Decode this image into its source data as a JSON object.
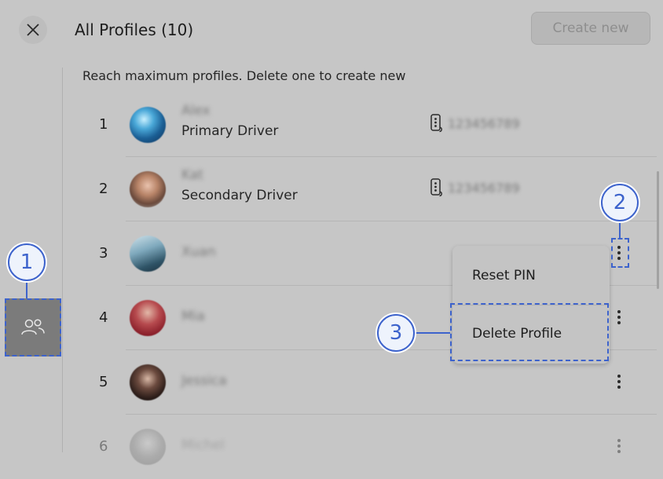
{
  "header": {
    "title": "All Profiles (10)",
    "create_label": "Create new"
  },
  "notice": "Reach maximum profiles. Delete one to create new",
  "profiles": [
    {
      "num": "1",
      "name": "Alex",
      "role": "Primary Driver",
      "phone": "123456789"
    },
    {
      "num": "2",
      "name": "Kat",
      "role": "Secondary Driver",
      "phone": "123456789"
    },
    {
      "num": "3",
      "name": "Xuan"
    },
    {
      "num": "4",
      "name": "Mia"
    },
    {
      "num": "5",
      "name": "Jessica"
    },
    {
      "num": "6",
      "name": "Michel"
    }
  ],
  "menu": {
    "reset_pin": "Reset PIN",
    "delete_profile": "Delete Profile"
  },
  "callouts": {
    "c1": "1",
    "c2": "2",
    "c3": "3"
  },
  "colors": {
    "highlight": "#3d63cc",
    "background": "#c6c6c6"
  },
  "icons": {
    "close": "close-icon",
    "profiles": "people-icon",
    "phone": "phone-icon",
    "more": "more-vertical-icon"
  }
}
